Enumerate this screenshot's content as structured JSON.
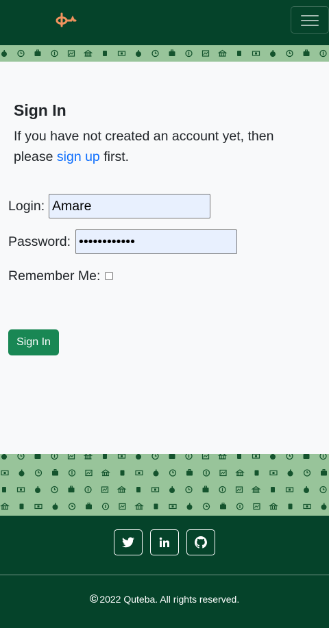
{
  "navbar": {
    "brand_icon": "quteba-logo-icon",
    "menu_icon": "hamburger-menu-icon"
  },
  "signin": {
    "title": "Sign In",
    "intro_before": "If you have not created an account yet, then please ",
    "signup_link": "sign up",
    "intro_after": " first.",
    "login_label": "Login:",
    "login_value": "Amare",
    "password_label": "Password:",
    "password_value": "••••••••••••",
    "remember_label": "Remember Me:",
    "remember_checked": false,
    "submit_label": "Sign In"
  },
  "footer": {
    "social_icons": [
      "twitter-icon",
      "linkedin-icon",
      "github-icon"
    ],
    "copyright": "2022 Quteba. All rights reserved."
  },
  "colors": {
    "navbar_bg": "#05432a",
    "pattern_bg": "#98c49a",
    "pattern_fg": "#14532d",
    "link": "#0d6efd",
    "button": "#198754"
  }
}
